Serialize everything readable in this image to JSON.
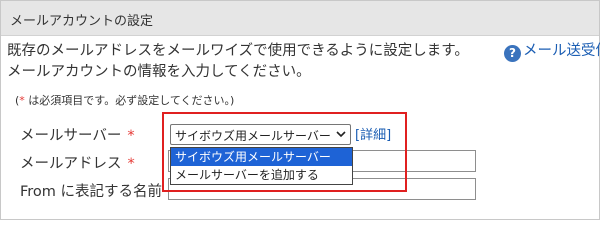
{
  "header": {
    "title": "メールアカウントの設定"
  },
  "intro": {
    "line1": "既存のメールアドレスをメールワイズで使用できるように設定します。",
    "line2": "メールアカウントの情報を入力してください。"
  },
  "help": {
    "icon": "question-circle-icon",
    "label": "メール送受信"
  },
  "note": {
    "asterisk": "*",
    "text": " は必須項目です。必ず設定してください。",
    "open": "(",
    "close": ")"
  },
  "form": {
    "required_mark": "*",
    "mail_server_label": "メールサーバー",
    "mail_address_label": "メールアドレス",
    "from_name_label": "From に表記する名前",
    "mail_server_selected": "サイボウズ用メールサーバー",
    "detail_link": "[詳細]",
    "dropdown_options": [
      "サイボウズ用メールサーバー",
      "メールサーバーを追加する"
    ]
  },
  "colors": {
    "required": "#e53935",
    "link": "#1a5db3",
    "highlight": "#e02020",
    "selected_option": "#1e63d6"
  }
}
